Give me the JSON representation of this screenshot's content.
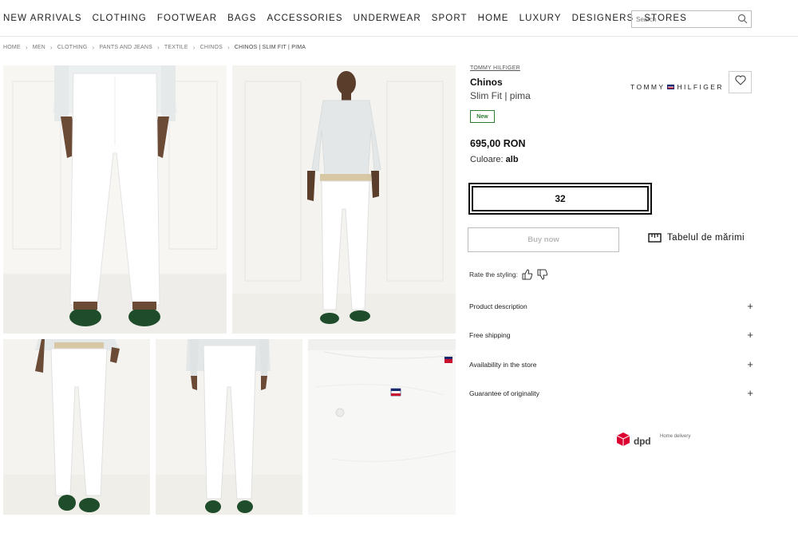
{
  "nav": {
    "menu": [
      "NEW ARRIVALS",
      "CLOTHING",
      "FOOTWEAR",
      "BAGS",
      "ACCESSORIES",
      "UNDERWEAR",
      "SPORT",
      "HOME",
      "LUXURY",
      "DESIGNERS",
      "STORES"
    ],
    "search_placeholder": "Search"
  },
  "breadcrumb": [
    "HOME",
    "MEN",
    "CLOTHING",
    "PANTS AND JEANS",
    "TEXTILE",
    "CHINOS",
    "CHINOS | SLIM FIT | PIMA"
  ],
  "product": {
    "brand_link": "TOMMY HILFIGER",
    "name": "Chinos",
    "subtitle": "Slim Fit | pima",
    "brand_logo_left": "TOMMY",
    "brand_logo_right": "HILFIGER",
    "badge": "New",
    "price": "695,00 RON",
    "color_label": "Culoare:",
    "color_value": "alb",
    "selected_size": "32",
    "buy_label": "Buy now",
    "size_table_label": "Tabelul de mărimi",
    "rate_label": "Rate the styling:"
  },
  "accordion": [
    "Product description",
    "Free shipping",
    "Availability in the store",
    "Guarantee of originality"
  ],
  "delivery": {
    "brand": "dpd",
    "note": "Home delivery"
  },
  "colors": {
    "new_badge": "#2f7d32",
    "dpd_red": "#dc0032",
    "shoe_green": "#1f4d2b",
    "belt_beige": "#d8c7a4"
  }
}
